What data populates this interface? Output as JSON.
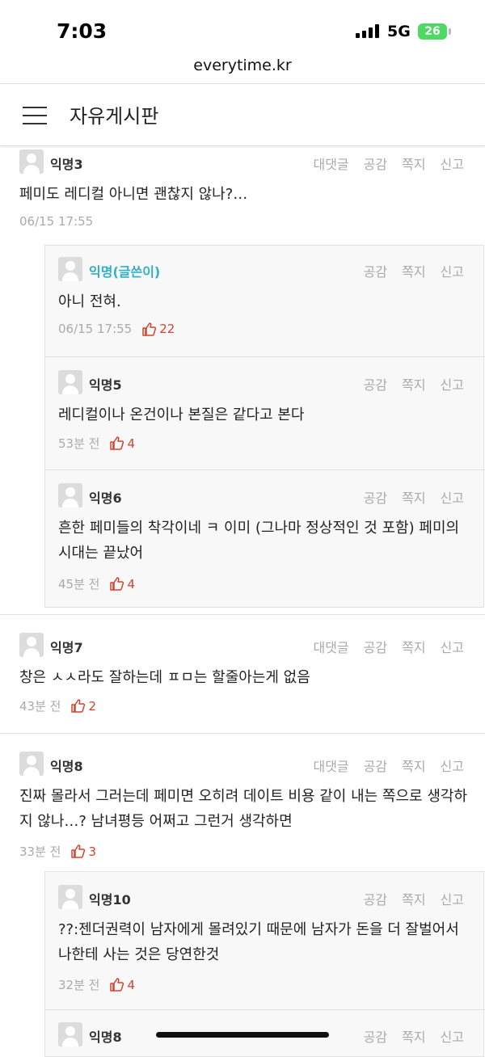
{
  "status": {
    "time": "7:03",
    "network": "5G",
    "battery": "26"
  },
  "browser": {
    "url": "everytime.kr"
  },
  "header": {
    "title": "자유게시판"
  },
  "actions": {
    "reply": "대댓글",
    "like": "공감",
    "message": "쪽지",
    "report": "신고"
  },
  "comments": [
    {
      "nick": "익명3",
      "text": "페미도 레디컬 아니면 괜찮지 않나?…",
      "time": "06/15 17:55",
      "likes": ""
    },
    {
      "nick": "익명(글쓴이)",
      "text": "아니 전혀.",
      "time": "06/15 17:55",
      "likes": "22"
    },
    {
      "nick": "익명5",
      "text": "레디컬이나 온건이나 본질은 같다고 본다",
      "time": "53분 전",
      "likes": "4"
    },
    {
      "nick": "익명6",
      "text": "흔한 페미들의 착각이네 ㅋ 이미 (그나마 정상적인 것 포함) 페미의 시대는 끝났어",
      "time": "45분 전",
      "likes": "4"
    },
    {
      "nick": "익명7",
      "text": "창은 ㅅㅅ라도 잘하는데 ㅍㅁ는 할줄아는게 없음",
      "time": "43분 전",
      "likes": "2"
    },
    {
      "nick": "익명8",
      "text": "진짜 몰라서 그러는데 페미면 오히려 데이트 비용 같이 내는 쪽으로 생각하지 않나…? 남녀평등 어쩌고 그런거 생각하면",
      "time": "33분 전",
      "likes": "3"
    },
    {
      "nick": "익명10",
      "text": "??:젠더권력이 남자에게 몰려있기 때문에 남자가 돈을 더 잘벌어서 나한테 사는 것은 당연한것",
      "time": "32분 전",
      "likes": "4"
    },
    {
      "nick": "익명8",
      "text": "",
      "time": "",
      "likes": ""
    }
  ]
}
